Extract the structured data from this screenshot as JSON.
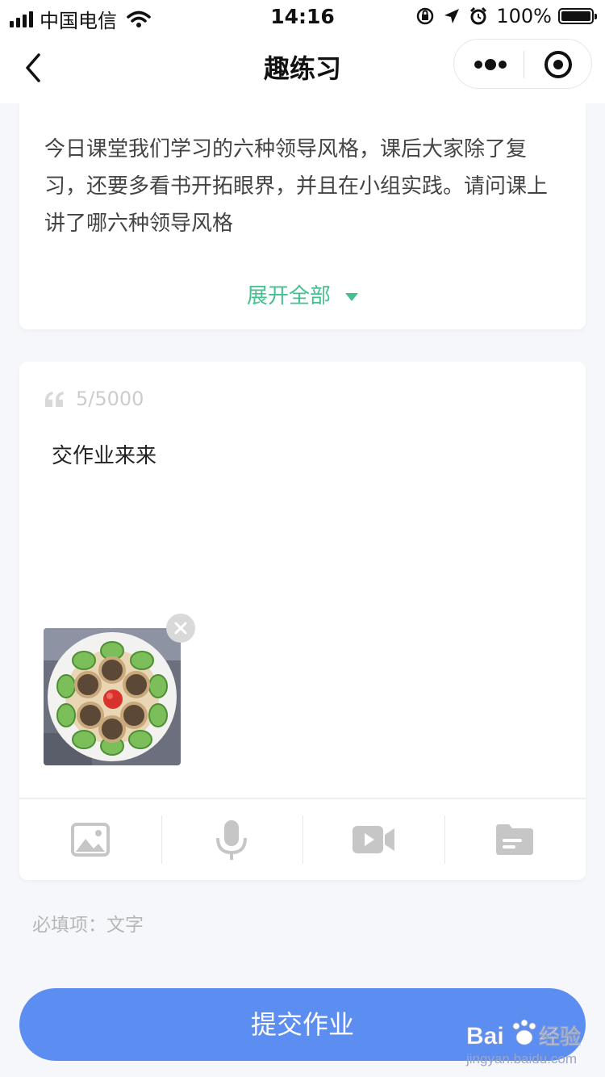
{
  "status_bar": {
    "carrier": "中国电信",
    "time": "14:16",
    "battery": "100%",
    "icons": [
      "signal-icon",
      "wifi-icon",
      "orientation-lock-icon",
      "location-icon",
      "alarm-icon",
      "battery-icon"
    ]
  },
  "nav": {
    "title": "趣练习",
    "icons": [
      "back-icon",
      "more-icon",
      "target-icon"
    ]
  },
  "question": {
    "text": "今日课堂我们学习的六种领导风格，课后大家除了复习，还要多看书开拓眼界，并且在小组实践。请问课上讲了哪六种领导风格",
    "expand_label": "展开全部"
  },
  "answer": {
    "counter": "5/5000",
    "text": "交作业来来",
    "attachments": [
      {
        "type": "image",
        "icon": "food-photo-thumbnail"
      }
    ]
  },
  "toolbar": {
    "tools": [
      "image-icon",
      "microphone-icon",
      "video-icon",
      "file-icon"
    ]
  },
  "required_note": "必填项：文字",
  "submit_label": "提交作业",
  "watermark": {
    "brand": "Bai 经验",
    "url": "jingyan.baidu.com"
  },
  "colors": {
    "accent_green": "#43c08e",
    "submit_blue": "#5c8df1",
    "page_bg": "#f6f7fb"
  }
}
